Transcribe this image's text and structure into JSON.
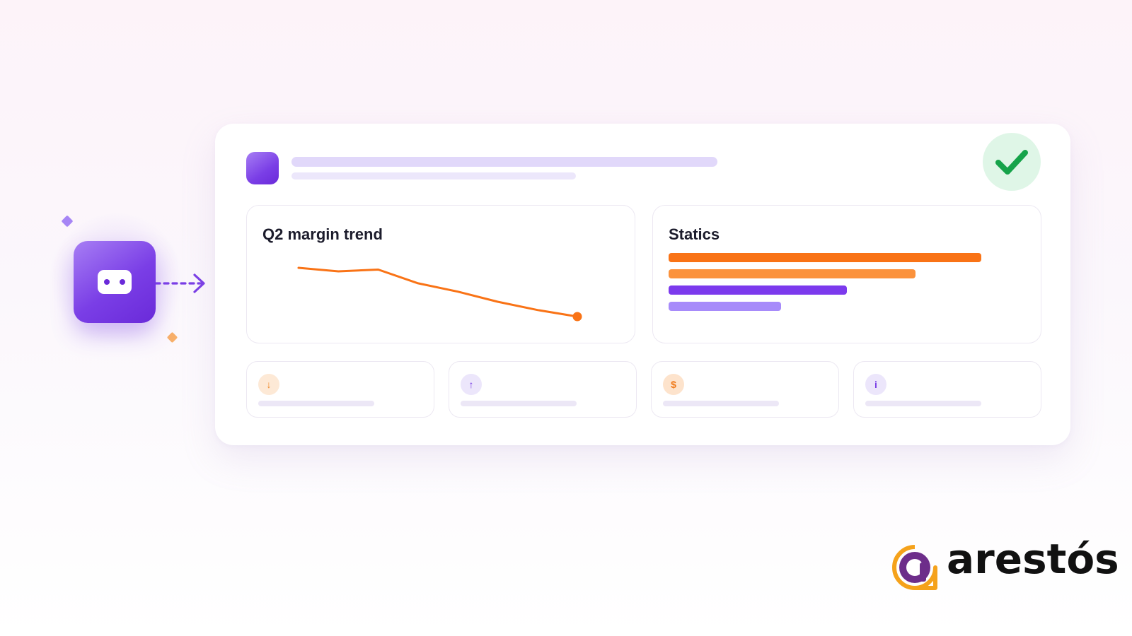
{
  "colors": {
    "accent_purple": "#7a3ee6",
    "accent_orange": "#f97316",
    "success_green": "#16a34a"
  },
  "agent": {
    "icon": "robot-icon"
  },
  "card": {
    "logo_icon": "app-logo-icon",
    "status_icon": "checkmark-icon"
  },
  "trend_panel": {
    "title": "Q2 margin trend",
    "chart_data": {
      "type": "line",
      "title": "Q2 margin trend",
      "x": [
        1,
        2,
        3,
        4,
        5,
        6,
        7,
        8
      ],
      "values": [
        100,
        94,
        97,
        74,
        60,
        43,
        29,
        18
      ],
      "color": "#f97316",
      "endpoint_marker": true,
      "grid": false
    }
  },
  "stats_panel": {
    "title": "Statics",
    "chart_data": {
      "type": "bar",
      "orientation": "horizontal",
      "title": "Statics",
      "values": [
        100,
        79,
        57,
        36
      ],
      "colors": [
        "#f97316",
        "#fb923c",
        "#7c3aed",
        "#a78bfa"
      ]
    }
  },
  "mini_cards": [
    {
      "icon": "down-arrow-icon",
      "glyph": "↓",
      "bg": "#fde9d6",
      "color": "#f08a2c"
    },
    {
      "icon": "up-arrow-icon",
      "glyph": "↑",
      "bg": "#ece6fb",
      "color": "#7a3ee6"
    },
    {
      "icon": "dollar-icon",
      "glyph": "$",
      "bg": "#fde3cc",
      "color": "#f07a1a"
    },
    {
      "icon": "info-icon",
      "glyph": "i",
      "bg": "#ece6fb",
      "color": "#7a3ee6"
    }
  ],
  "brand": {
    "name": "arestós",
    "icon": "arestos-logo-icon"
  }
}
